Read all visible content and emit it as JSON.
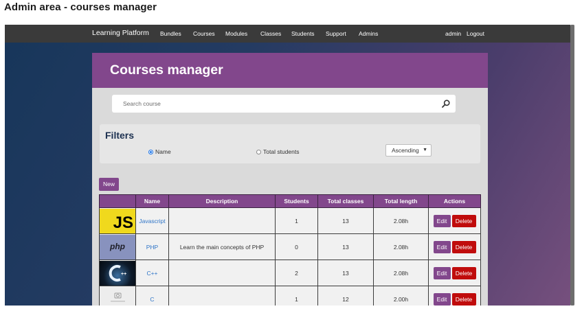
{
  "caption": "Admin area - courses manager",
  "navbar": {
    "brand": "Learning Platform",
    "links": [
      "Bundles",
      "Courses",
      "Modules",
      "Classes",
      "Students",
      "Support",
      "Admins"
    ],
    "user": "admin",
    "logout": "Logout"
  },
  "panel": {
    "title": "Courses manager",
    "search_placeholder": "Search course"
  },
  "filters": {
    "title": "Filters",
    "options": [
      {
        "label": "Name",
        "checked": true
      },
      {
        "label": "Total students",
        "checked": false
      }
    ],
    "sort_selected": "Ascending"
  },
  "new_label": "New",
  "table": {
    "headers": [
      "",
      "Name",
      "Description",
      "Students",
      "Total classes",
      "Total length",
      "Actions"
    ],
    "rows": [
      {
        "thumb_text": "JS",
        "name": "Javascript",
        "description": "",
        "students": "1",
        "classes": "13",
        "length": "2.08h"
      },
      {
        "thumb_text": "php",
        "name": "PHP",
        "description": "Learn the main concepts of PHP",
        "students": "0",
        "classes": "13",
        "length": "2.08h"
      },
      {
        "thumb_text": "",
        "name": "C++",
        "description": "",
        "students": "2",
        "classes": "13",
        "length": "2.08h"
      },
      {
        "thumb_text": "",
        "name": "C",
        "description": "",
        "students": "1",
        "classes": "12",
        "length": "2.00h"
      }
    ],
    "edit_label": "Edit",
    "delete_label": "Delete"
  },
  "colors": {
    "accent": "#82478c",
    "danger": "#c00c0c",
    "navbar": "#3a3a3a"
  }
}
